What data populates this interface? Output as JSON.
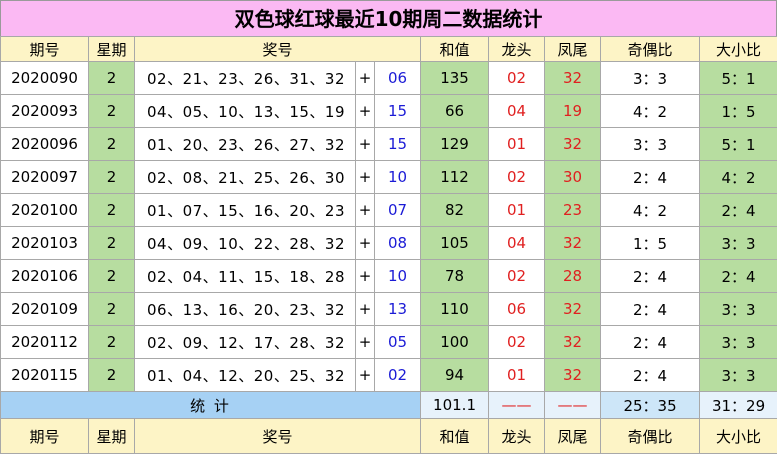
{
  "title": "双色球红球最近10期周二数据统计",
  "headers": {
    "period": "期号",
    "weekday": "星期",
    "numbers": "奖号",
    "sum": "和值",
    "head": "龙头",
    "tail": "凤尾",
    "odd_even": "奇偶比",
    "big_small": "大小比"
  },
  "plus_sign": "+",
  "rows": [
    {
      "period": "2020090",
      "weekday": "2",
      "reds": "02、21、23、26、31、32",
      "blue": "06",
      "sum": "135",
      "head": "02",
      "tail": "32",
      "odd_even": "3：3",
      "big_small": "5：1"
    },
    {
      "period": "2020093",
      "weekday": "2",
      "reds": "04、05、10、13、15、19",
      "blue": "15",
      "sum": "66",
      "head": "04",
      "tail": "19",
      "odd_even": "4：2",
      "big_small": "1：5"
    },
    {
      "period": "2020096",
      "weekday": "2",
      "reds": "01、20、23、26、27、32",
      "blue": "15",
      "sum": "129",
      "head": "01",
      "tail": "32",
      "odd_even": "3：3",
      "big_small": "5：1"
    },
    {
      "period": "2020097",
      "weekday": "2",
      "reds": "02、08、21、25、26、30",
      "blue": "10",
      "sum": "112",
      "head": "02",
      "tail": "30",
      "odd_even": "2：4",
      "big_small": "4：2"
    },
    {
      "period": "2020100",
      "weekday": "2",
      "reds": "01、07、15、16、20、23",
      "blue": "07",
      "sum": "82",
      "head": "01",
      "tail": "23",
      "odd_even": "4：2",
      "big_small": "2：4"
    },
    {
      "period": "2020103",
      "weekday": "2",
      "reds": "04、09、10、22、28、32",
      "blue": "08",
      "sum": "105",
      "head": "04",
      "tail": "32",
      "odd_even": "1：5",
      "big_small": "3：3"
    },
    {
      "period": "2020106",
      "weekday": "2",
      "reds": "02、04、11、15、18、28",
      "blue": "10",
      "sum": "78",
      "head": "02",
      "tail": "28",
      "odd_even": "2：4",
      "big_small": "2：4"
    },
    {
      "period": "2020109",
      "weekday": "2",
      "reds": "06、13、16、20、23、32",
      "blue": "13",
      "sum": "110",
      "head": "06",
      "tail": "32",
      "odd_even": "2：4",
      "big_small": "3：3"
    },
    {
      "period": "2020112",
      "weekday": "2",
      "reds": "02、09、12、17、28、32",
      "blue": "05",
      "sum": "100",
      "head": "02",
      "tail": "32",
      "odd_even": "2：4",
      "big_small": "3：3"
    },
    {
      "period": "2020115",
      "weekday": "2",
      "reds": "01、04、12、20、25、32",
      "blue": "02",
      "sum": "94",
      "head": "01",
      "tail": "32",
      "odd_even": "2：4",
      "big_small": "3：3"
    }
  ],
  "stats": {
    "label": "统 计",
    "sum": "101.1",
    "head": "——",
    "tail": "——",
    "odd_even": "25：35",
    "big_small": "31：29"
  },
  "colors": {
    "title_bg": "#fbb9f3",
    "header_bg": "#fdf4c6",
    "green_col": "#b7dda0",
    "stat_bg": "#a6d1f4",
    "blue_ball": "#1b1bd6",
    "red_text": "#e02020"
  }
}
